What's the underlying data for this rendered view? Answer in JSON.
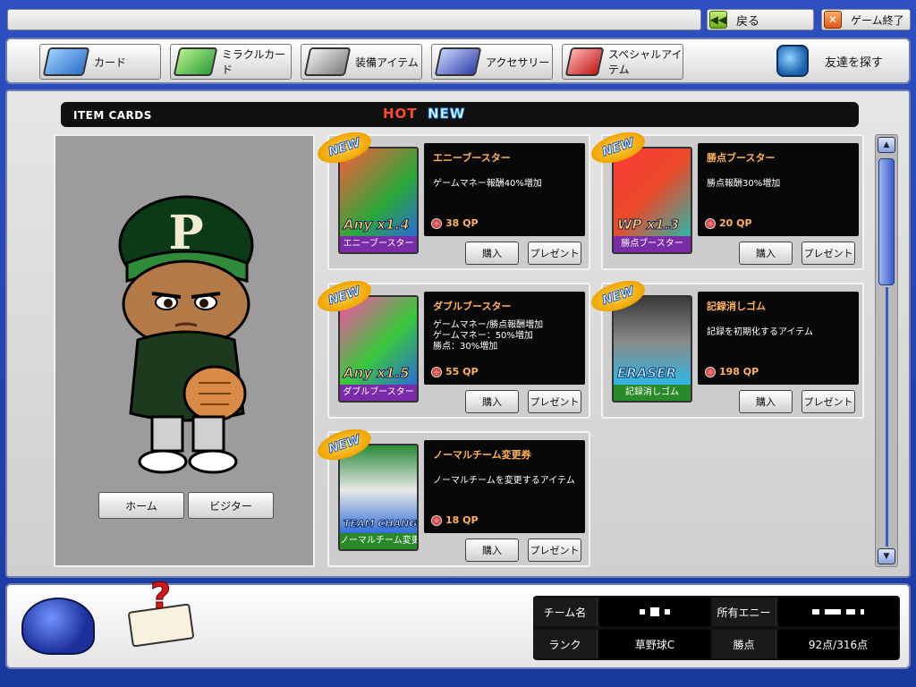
{
  "topbar": {
    "back_label": "戻る",
    "exit_label": "ゲーム終了",
    "back_icon": "double-left-arrow-icon",
    "exit_icon": "close-x-icon"
  },
  "nav": {
    "items": [
      {
        "label": "カード",
        "icon": "card-icon"
      },
      {
        "label": "ミラクルカード",
        "icon": "miracle-card-icon"
      },
      {
        "label": "装備アイテム",
        "icon": "equipment-item-icon"
      },
      {
        "label": "アクセサリー",
        "icon": "accessory-icon"
      },
      {
        "label": "スペシャルアイテム",
        "icon": "special-item-icon"
      }
    ],
    "friend_label": "友達を探す"
  },
  "main": {
    "header_title": "ITEM CARDS",
    "tab_hot": "HOT",
    "tab_new": "NEW"
  },
  "character": {
    "home_label": "ホーム",
    "visitor_label": "ビジター",
    "cap_letter": "P"
  },
  "cards": [
    {
      "badge": "NEW",
      "name": "エニーブースター",
      "desc": "ゲームマネー報酬40%増加",
      "price": "38 QP",
      "caption": "エニーブースター",
      "art_text": "Any x1.4",
      "buy": "購入",
      "present": "プレゼント"
    },
    {
      "badge": "NEW",
      "name": "勝点ブースター",
      "desc": "勝点報酬30%増加",
      "price": "20 QP",
      "caption": "勝点ブースター",
      "art_text": "WP x1.3",
      "buy": "購入",
      "present": "プレゼント"
    },
    {
      "badge": "NEW",
      "name": "ダブルブースター",
      "desc": "ゲームマネー/勝点報酬増加\nゲームマネー：50%増加\n勝点：30%増加",
      "price": "55 QP",
      "caption": "ダブルブースター",
      "art_text": "Any x1.5",
      "buy": "購入",
      "present": "プレゼント"
    },
    {
      "badge": "NEW",
      "name": "記録消しゴム",
      "desc": "記録を初期化するアイテム",
      "price": "198 QP",
      "caption": "記録消しゴム",
      "art_text": "ERASER",
      "buy": "購入",
      "present": "プレゼント"
    },
    {
      "badge": "NEW",
      "name": "ノーマルチーム変更券",
      "desc": "ノーマルチームを変更するアイテム",
      "price": "18 QP",
      "caption": "ノーマルチーム変更券",
      "art_text": "TEAM CHANGE",
      "buy": "購入",
      "present": "プレゼント"
    }
  ],
  "status": {
    "team_label": "チーム名",
    "money_label": "所有エニー",
    "rank_label": "ランク",
    "rank_value": "草野球C",
    "points_label": "勝点",
    "points_value": "92点/316点"
  },
  "colors": {
    "accent_orange": "#ffb25a",
    "hot_red": "#ff4a2a",
    "frame_blue": "#1f3fa8"
  }
}
